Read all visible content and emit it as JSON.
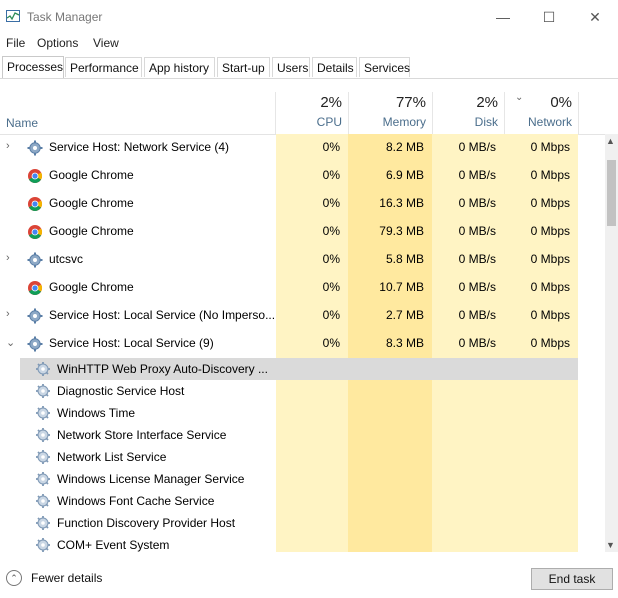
{
  "window": {
    "title": "Task Manager"
  },
  "menu": [
    "File",
    "Options",
    "View"
  ],
  "tabs": [
    "Processes",
    "Performance",
    "App history",
    "Start-up",
    "Users",
    "Details",
    "Services"
  ],
  "header": {
    "name_label": "Name",
    "cpu": {
      "pct": "2%",
      "label": "CPU"
    },
    "memory": {
      "pct": "77%",
      "label": "Memory"
    },
    "disk": {
      "pct": "2%",
      "label": "Disk"
    },
    "network": {
      "pct": "0%",
      "label": "Network"
    }
  },
  "processes": [
    {
      "name": "Service Host: Network Service (4)",
      "icon": "gear-icon",
      "chevron": "›",
      "cpu": "0%",
      "memory": "8.2 MB",
      "disk": "0 MB/s",
      "network": "0 Mbps"
    },
    {
      "name": "Google Chrome",
      "icon": "chrome-icon",
      "chevron": "",
      "cpu": "0%",
      "memory": "6.9 MB",
      "disk": "0 MB/s",
      "network": "0 Mbps"
    },
    {
      "name": "Google Chrome",
      "icon": "chrome-icon",
      "chevron": "",
      "cpu": "0%",
      "memory": "16.3 MB",
      "disk": "0 MB/s",
      "network": "0 Mbps"
    },
    {
      "name": "Google Chrome",
      "icon": "chrome-icon",
      "chevron": "",
      "cpu": "0%",
      "memory": "79.3 MB",
      "disk": "0 MB/s",
      "network": "0 Mbps"
    },
    {
      "name": "utcsvc",
      "icon": "gear-icon",
      "chevron": "›",
      "cpu": "0%",
      "memory": "5.8 MB",
      "disk": "0 MB/s",
      "network": "0 Mbps"
    },
    {
      "name": "Google Chrome",
      "icon": "chrome-icon",
      "chevron": "",
      "cpu": "0%",
      "memory": "10.7 MB",
      "disk": "0 MB/s",
      "network": "0 Mbps"
    },
    {
      "name": "Service Host: Local Service (No Imperso...",
      "icon": "gear-icon",
      "chevron": "›",
      "cpu": "0%",
      "memory": "2.7 MB",
      "disk": "0 MB/s",
      "network": "0 Mbps"
    },
    {
      "name": "Service Host: Local Service (9)",
      "icon": "gear-icon",
      "chevron": "⌄",
      "cpu": "0%",
      "memory": "8.3 MB",
      "disk": "0 MB/s",
      "network": "0 Mbps"
    }
  ],
  "child_services": [
    "WinHTTP Web Proxy Auto-Discovery ...",
    "Diagnostic Service Host",
    "Windows Time",
    "Network Store Interface Service",
    "Network List Service",
    "Windows License Manager Service",
    "Windows Font Cache Service",
    "Function Discovery Provider Host",
    "COM+ Event System"
  ],
  "footer": {
    "fewer_details": "Fewer details",
    "end_task": "End task"
  }
}
